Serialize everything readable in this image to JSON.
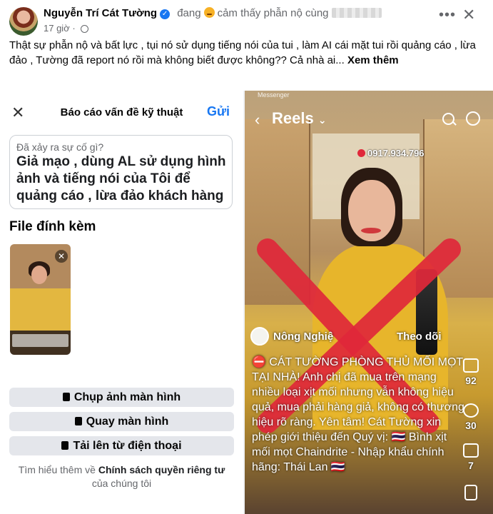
{
  "post": {
    "author": "Nguyễn Trí Cát Tường",
    "feeling_text": "đang",
    "feeling_word": "cảm thấy phẫn nộ cùng",
    "time": "17 giờ",
    "text": "Thật sự phẫn nộ và bất lực , tụi nó sử dụng tiếng nói của tui , làm AI cái mặt tui rồi quảng cáo , lừa đảo , Tường đã report nó rồi mà không biết được không?? Cả nhà ai...",
    "see_more": "Xem thêm"
  },
  "report": {
    "title": "Báo cáo vấn đề kỹ thuật",
    "send": "Gửi",
    "question_label": "Đã xảy ra sự cố gì?",
    "answer": "Giả mạo , dùng AL sử dụng hình ảnh và tiếng nói của Tôi để quảng cáo , lừa đảo khách hàng",
    "attachments_label": "File đính kèm",
    "buttons": [
      "Chụp ảnh màn hình",
      "Quay màn hình",
      "Tải lên từ điện thoại"
    ],
    "footer_prefix": "Tìm hiểu thêm về",
    "footer_link": "Chính sách quyền riêng tư",
    "footer_suffix": "của chúng tôi"
  },
  "reel": {
    "app": "Messenger",
    "title": "Reels",
    "phone": "0917.934.796",
    "page_name": "Nông Nghiệ",
    "follow": "Theo dõi",
    "caption": "⛔ CÁT TƯỜNG PHÒNG THỦ MỐI MỌT TẠI NHÀ! Anh chị đã mua trên mạng nhiều loại xịt mối nhưng vẫn không hiệu quả, mua phải hàng giả, không có thương hiệu rõ ràng. Yên tâm! Cát Tường xin phép giới thiệu đến Quý vị: 🇹🇭 Bình xịt mối mọt Chaindrite - Nhập khẩu chính hãng: Thái Lan 🇹🇭",
    "likes": "92",
    "comments": "30",
    "shares": "7",
    "accent": "#e0283a"
  }
}
